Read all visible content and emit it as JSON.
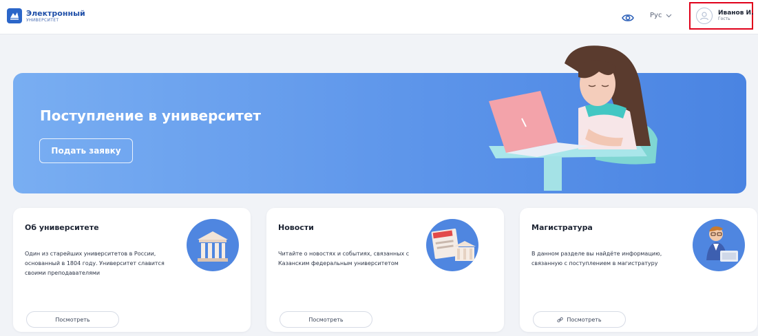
{
  "header": {
    "logo": {
      "title": "Электронный",
      "subtitle": "УНИВЕРСИТЕТ",
      "icon": "university-logo-icon"
    },
    "accessibility_icon": "eye-icon",
    "language": {
      "label": "Рус",
      "icon": "chevron-down-icon"
    },
    "user": {
      "name": "Иванов И.",
      "role": "Гость",
      "icon": "user-avatar-icon"
    }
  },
  "hero": {
    "title": "Поступление в университет",
    "button_label": "Подать заявку",
    "illustration": "girl-with-laptop-illustration"
  },
  "cards": [
    {
      "title": "Об университете",
      "description": "Один из старейших университетов в России, основанный в 1804 году. Университет славится своими преподавателями",
      "button_label": "Посмотреть",
      "icon": "university-building-icon"
    },
    {
      "title": "Новости",
      "description": "Читайте о новостях и событиях, связанных с Казанским федеральным университетом",
      "button_label": "Посмотреть",
      "icon": "news-icon"
    },
    {
      "title": "Магистратура",
      "description": "В данном разделе вы найдёте информацию, связанную с поступлением в магистратуру",
      "button_label": "Посмотреть",
      "icon": "student-with-laptop-icon",
      "button_icon": "link-icon"
    }
  ],
  "colors": {
    "brand": "#2b66c9",
    "hero_gradient_start": "#79aef2",
    "hero_gradient_end": "#4a84e2",
    "highlight_border": "#e0001a"
  }
}
